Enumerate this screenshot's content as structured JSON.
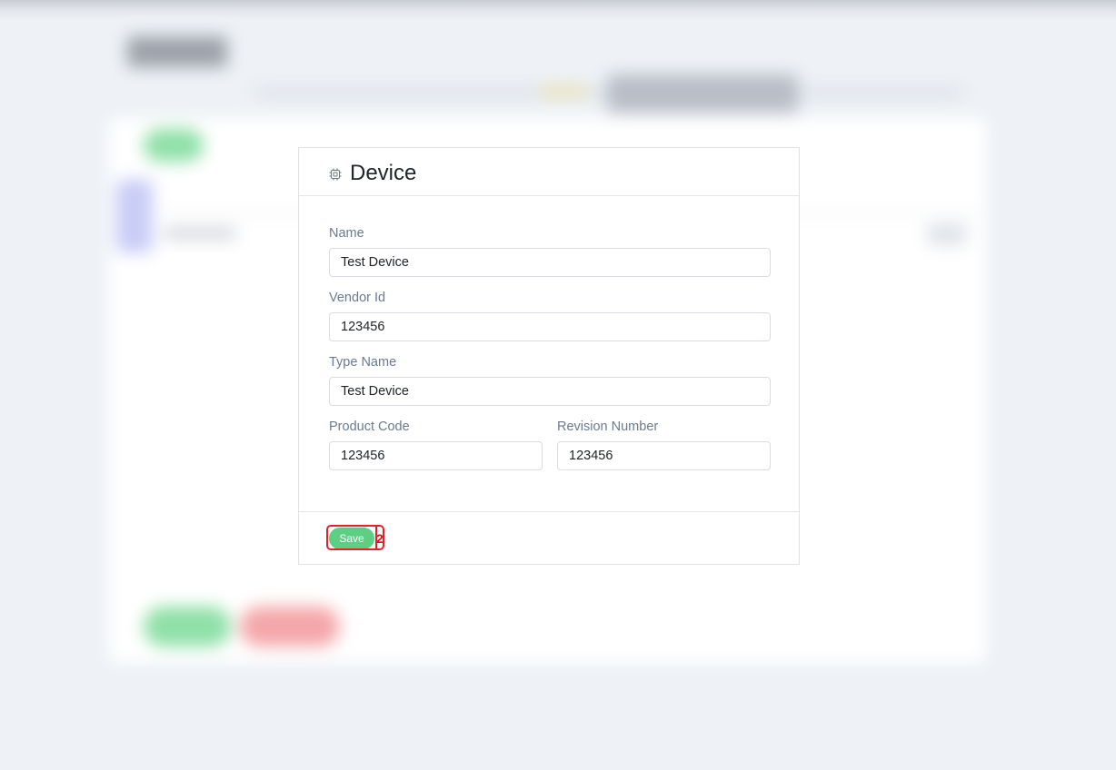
{
  "modal": {
    "title": "Device",
    "icon": "chip-icon",
    "fields": {
      "name": {
        "label": "Name",
        "value": "Test Device"
      },
      "vendor_id": {
        "label": "Vendor Id",
        "value": "123456"
      },
      "type_name": {
        "label": "Type Name",
        "value": "Test Device"
      },
      "product_code": {
        "label": "Product Code",
        "value": "123456"
      },
      "revision_number": {
        "label": "Revision Number",
        "value": "123456"
      }
    },
    "save_label": "Save",
    "annotation_label": "2"
  },
  "colors": {
    "accent_green": "#5ccf83",
    "annotation_red": "#e8202a",
    "label_gray": "#6b7a90"
  }
}
